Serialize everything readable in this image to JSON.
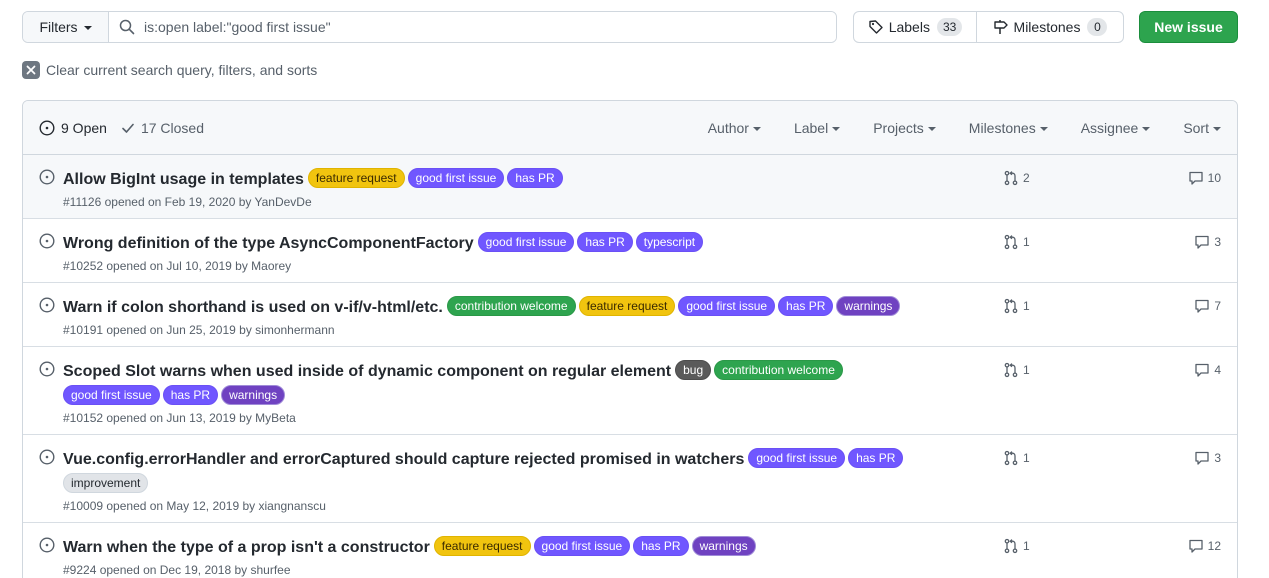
{
  "toolbar": {
    "filters_label": "Filters",
    "search_value": "is:open label:\"good first issue\"",
    "labels_label": "Labels",
    "labels_count": "33",
    "milestones_label": "Milestones",
    "milestones_count": "0",
    "new_issue_label": "New issue",
    "clear_text": "Clear current search query, filters, and sorts"
  },
  "header": {
    "open_label": "9 Open",
    "closed_label": "17 Closed",
    "menus": [
      "Author",
      "Label",
      "Projects",
      "Milestones",
      "Assignee",
      "Sort"
    ]
  },
  "label_styles": {
    "feature request": {
      "bg": "#f1c40f",
      "fg": "#3a2a00",
      "border": "#e0b400"
    },
    "good first issue": {
      "bg": "#7057ff",
      "fg": "#ffffff",
      "border": "#6a50f5"
    },
    "has PR": {
      "bg": "#7057ff",
      "fg": "#ffffff",
      "border": "#6a50f5"
    },
    "typescript": {
      "bg": "#7057ff",
      "fg": "#ffffff",
      "border": "#6a50f5"
    },
    "contribution welcome": {
      "bg": "#2ea44f",
      "fg": "#ffffff",
      "border": "#2a9847"
    },
    "warnings": {
      "bg": "#6f42c1",
      "fg": "#ffffff",
      "border": "#a08cd8"
    },
    "bug": {
      "bg": "#5a5a5a",
      "fg": "#ffffff",
      "border": "#4d4d4d"
    },
    "improvement": {
      "bg": "#e1e4e8",
      "fg": "#24292f",
      "border": "#d0d7de"
    }
  },
  "issues": [
    {
      "title": "Allow BigInt usage in templates",
      "labels": [
        "feature request",
        "good first issue",
        "has PR"
      ],
      "meta": "#11126 opened on Feb 19, 2020 by YanDevDe",
      "prs": "2",
      "comments": "10"
    },
    {
      "title": "Wrong definition of the type AsyncComponentFactory",
      "labels": [
        "good first issue",
        "has PR",
        "typescript"
      ],
      "meta": "#10252 opened on Jul 10, 2019 by Maorey",
      "prs": "1",
      "comments": "3"
    },
    {
      "title": "Warn if colon shorthand is used on v-if/v-html/etc.",
      "labels": [
        "contribution welcome",
        "feature request",
        "good first issue",
        "has PR",
        "warnings"
      ],
      "meta": "#10191 opened on Jun 25, 2019 by simonhermann",
      "prs": "1",
      "comments": "7"
    },
    {
      "title": "Scoped Slot warns when used inside of dynamic component on regular element",
      "labels": [
        "bug",
        "contribution welcome",
        "good first issue",
        "has PR",
        "warnings"
      ],
      "meta": "#10152 opened on Jun 13, 2019 by MyBeta",
      "prs": "1",
      "comments": "4"
    },
    {
      "title": "Vue.config.errorHandler and errorCaptured should capture rejected promised in watchers",
      "labels": [
        "good first issue",
        "has PR",
        "improvement"
      ],
      "meta": "#10009 opened on May 12, 2019 by xiangnanscu",
      "prs": "1",
      "comments": "3"
    },
    {
      "title": "Warn when the type of a prop isn't a constructor",
      "labels": [
        "feature request",
        "good first issue",
        "has PR",
        "warnings"
      ],
      "meta": "#9224 opened on Dec 19, 2018 by shurfee",
      "prs": "1",
      "comments": "12"
    }
  ]
}
